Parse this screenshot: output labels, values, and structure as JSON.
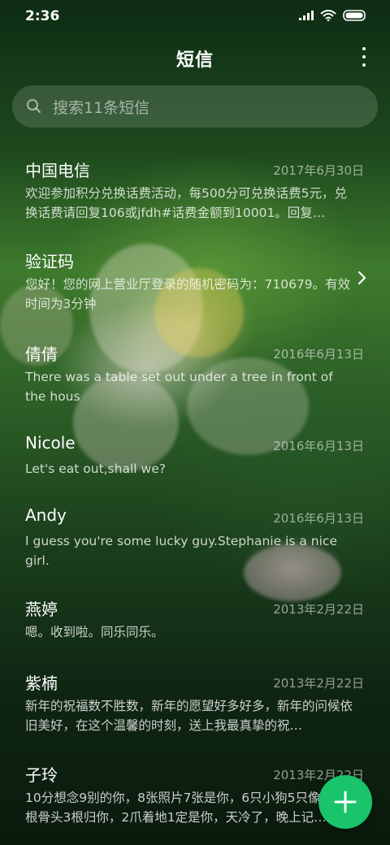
{
  "status_bar": {
    "time": "2:36",
    "icons": [
      "signal-icon",
      "wifi-icon",
      "battery-icon"
    ]
  },
  "header": {
    "title": "短信",
    "menu_icon": "more-vertical-icon"
  },
  "search": {
    "icon": "search-icon",
    "placeholder": "搜索11条短信"
  },
  "conversations": [
    {
      "name": "中国电信",
      "date": "2017年6月30日",
      "preview": "欢迎参加积分兑换话费活动，每500分可兑换话费5元，兑换话费请回复106或jfdh#话费金额到10001。回复…"
    },
    {
      "name": "验证码",
      "date": "",
      "preview": "您好！您的网上营业厅登录的随机密码为：710679。有效时间为3分钟",
      "has_chevron": true
    },
    {
      "name": "倩倩",
      "date": "2016年6月13日",
      "preview": "There was a table set out under a tree in front of the hous"
    },
    {
      "name": "Nicole",
      "date": "2016年6月13日",
      "preview": "Let's eat out,shall we?"
    },
    {
      "name": "Andy",
      "date": "2016年6月13日",
      "preview": "I guess you're some lucky guy.Stephanie is a nice girl."
    },
    {
      "name": "燕婷",
      "date": "2013年2月22日",
      "preview": "嗯。收到啦。同乐同乐。"
    },
    {
      "name": "紫楠",
      "date": "2013年2月22日",
      "preview": "新年的祝福数不胜数，新年的愿望好多好多，新年的问候依旧美好，在这个温馨的时刻，送上我最真挚的祝…"
    },
    {
      "name": "子玲",
      "date": "2013年2月22日",
      "preview": "10分想念9别的你，8张照片7张是你，6只小狗5只像你，4根骨头3根归你，2爪着地1定是你，天冷了，晚上记…"
    }
  ],
  "fab": {
    "icon": "plus-icon",
    "color": "#19c46a"
  }
}
